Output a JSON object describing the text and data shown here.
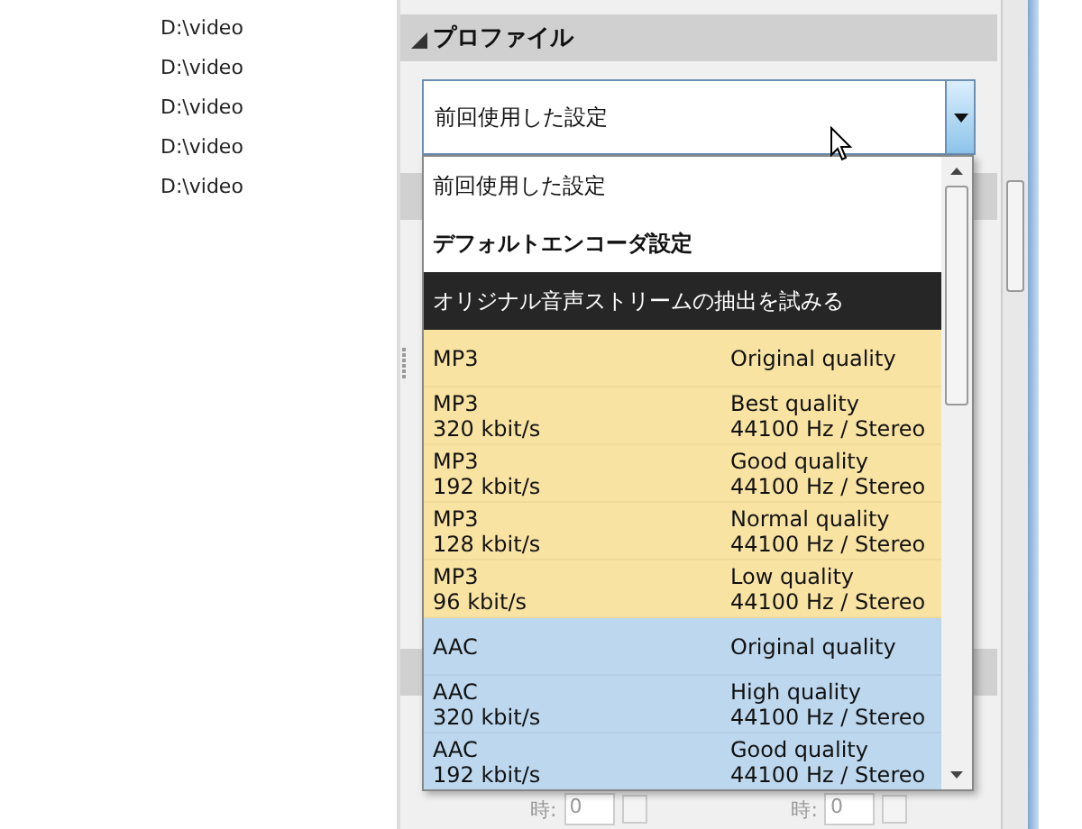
{
  "file_list": {
    "items": [
      "D:\\video",
      "D:\\video",
      "D:\\video",
      "D:\\video",
      "D:\\video"
    ]
  },
  "profile_section": {
    "title": "プロファイル",
    "expanded": true
  },
  "profile_combo": {
    "value": "前回使用した設定",
    "expanded": true
  },
  "profile_options": [
    {
      "kind": "text",
      "label": "前回使用した設定",
      "bold": false,
      "selected": false
    },
    {
      "kind": "text",
      "label": "デフォルトエンコーダ設定",
      "bold": true,
      "selected": false
    },
    {
      "kind": "text",
      "label": "オリジナル音声ストリームの抽出を試みる",
      "bold": false,
      "selected": true
    },
    {
      "kind": "format",
      "color": "#f9e3a3",
      "codec": "MP3",
      "quality": "Original quality",
      "selected": false
    },
    {
      "kind": "format",
      "color": "#f9e3a3",
      "codec": "MP3",
      "bitrate": "320 kbit/s",
      "quality": "Best quality",
      "detail": "44100 Hz / Stereo",
      "selected": false
    },
    {
      "kind": "format",
      "color": "#f9e3a3",
      "codec": "MP3",
      "bitrate": "192 kbit/s",
      "quality": "Good quality",
      "detail": "44100 Hz / Stereo",
      "selected": false
    },
    {
      "kind": "format",
      "color": "#f9e3a3",
      "codec": "MP3",
      "bitrate": "128 kbit/s",
      "quality": "Normal quality",
      "detail": "44100 Hz / Stereo",
      "selected": false
    },
    {
      "kind": "format",
      "color": "#f9e3a3",
      "codec": "MP3",
      "bitrate": "96 kbit/s",
      "quality": "Low quality",
      "detail": "44100 Hz / Stereo",
      "selected": false
    },
    {
      "kind": "format",
      "color": "#bdd7ee",
      "codec": "AAC",
      "quality": "Original quality",
      "selected": false
    },
    {
      "kind": "format",
      "color": "#bdd7ee",
      "codec": "AAC",
      "bitrate": "320 kbit/s",
      "quality": "High quality",
      "detail": "44100 Hz / Stereo",
      "selected": false
    },
    {
      "kind": "format",
      "color": "#bdd7ee",
      "codec": "AAC",
      "bitrate": "192 kbit/s",
      "quality": "Good quality",
      "detail": "44100 Hz / Stereo",
      "selected": false
    }
  ],
  "time_fields": [
    {
      "label": "時:",
      "value": "0"
    },
    {
      "label": "時:",
      "value": "0"
    }
  ]
}
